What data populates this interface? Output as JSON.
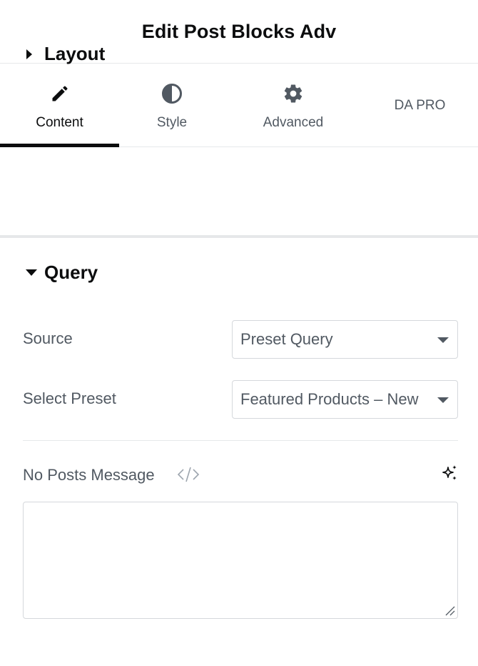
{
  "header": {
    "title": "Edit Post Blocks Adv"
  },
  "tabs": [
    {
      "label": "Content",
      "icon": "pencil-icon",
      "active": true
    },
    {
      "label": "Style",
      "icon": "contrast-icon",
      "active": false
    },
    {
      "label": "Advanced",
      "icon": "gear-icon",
      "active": false
    },
    {
      "label": "DA PRO",
      "active": false
    }
  ],
  "sections": {
    "layout": {
      "label": "Layout",
      "expanded": false
    },
    "query": {
      "label": "Query",
      "expanded": true
    }
  },
  "query": {
    "source": {
      "label": "Source",
      "value": "Preset Query"
    },
    "preset": {
      "label": "Select Preset",
      "value": "Featured Products – New"
    },
    "no_posts": {
      "label": "No Posts Message",
      "value": ""
    }
  },
  "colors": {
    "text_dark": "#0c0d0e",
    "text_muted": "#515962",
    "border": "#d5d8dc",
    "divider": "#e6e8ea"
  }
}
